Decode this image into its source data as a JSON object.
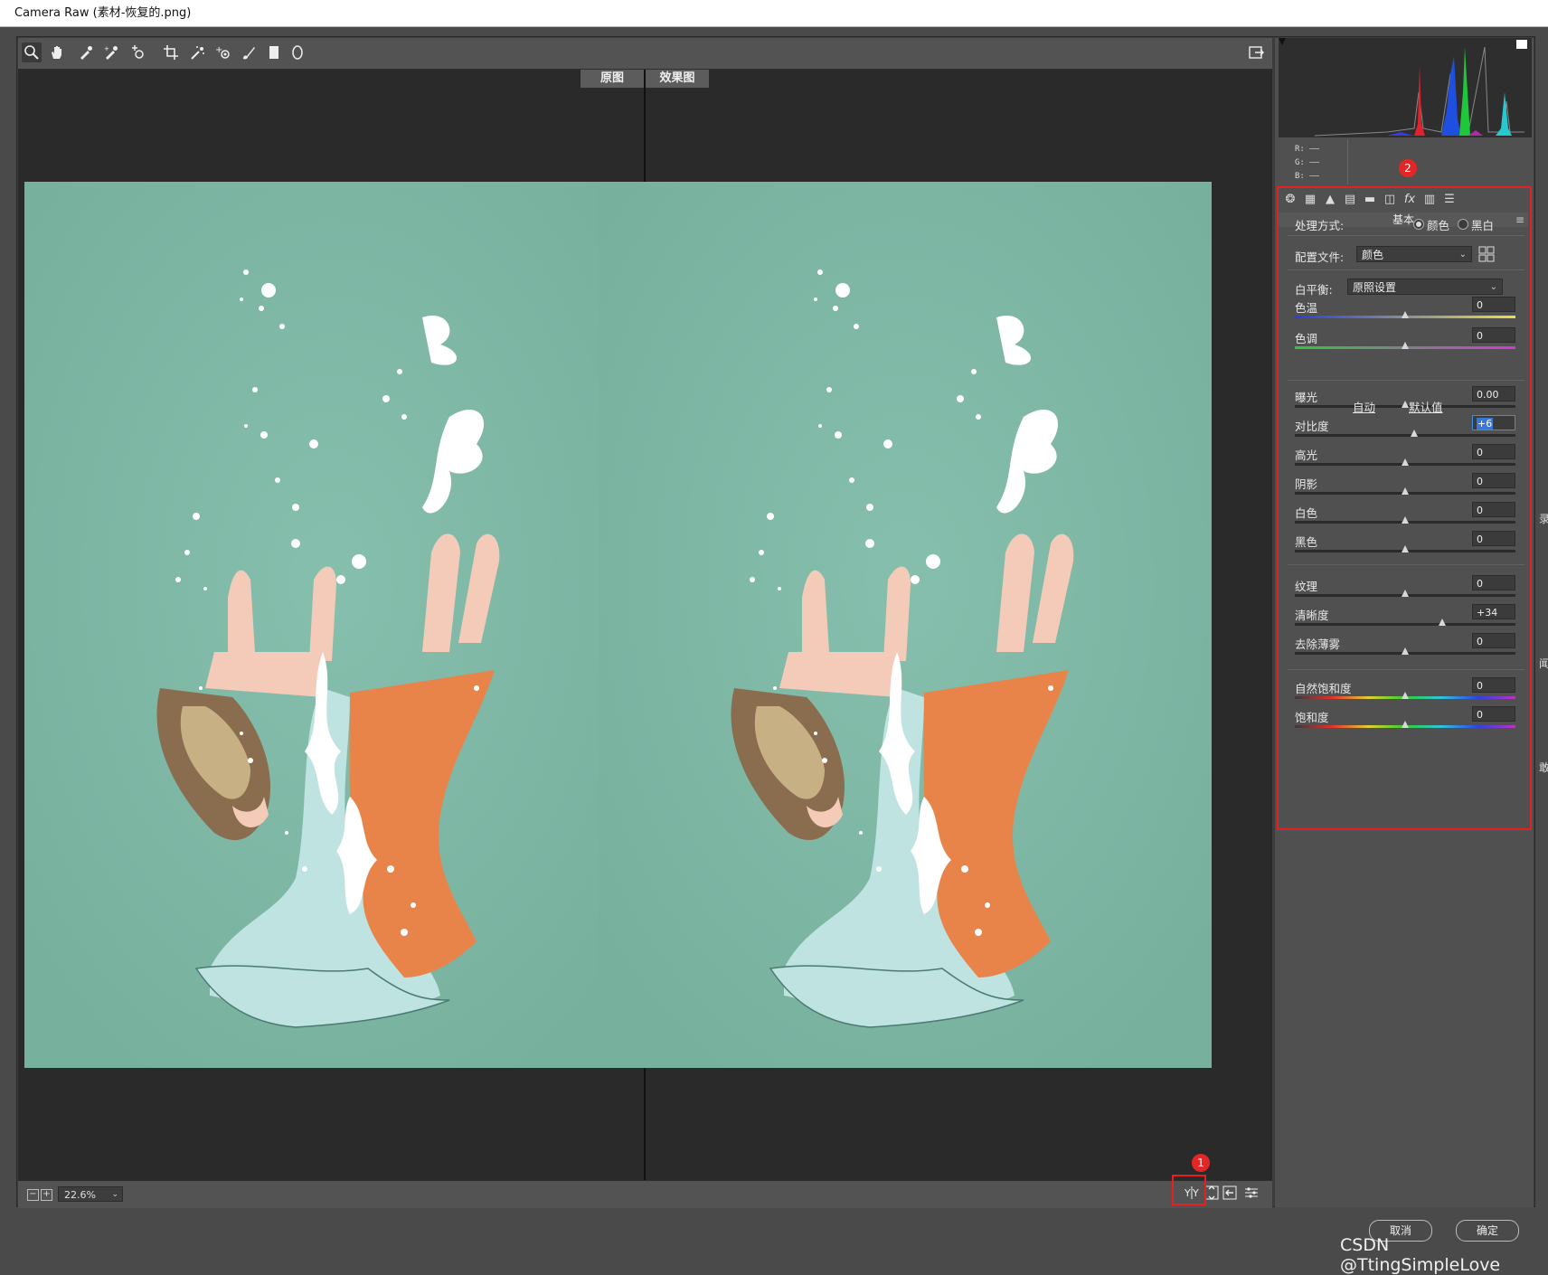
{
  "window": {
    "title": "Camera Raw (素材-恢复的.png)"
  },
  "toolbar": {
    "tools": [
      {
        "icon": "zoom-icon",
        "glyph": "🔍"
      },
      {
        "icon": "hand-icon",
        "glyph": "✋"
      },
      {
        "icon": "white-balance-icon",
        "glyph": "✎"
      },
      {
        "icon": "color-sampler-icon",
        "glyph": "✎"
      },
      {
        "icon": "targeted-adjustment-icon",
        "glyph": "⊕"
      },
      {
        "icon": "crop-icon",
        "glyph": "⌗"
      },
      {
        "icon": "spot-removal-icon",
        "glyph": "✦"
      },
      {
        "icon": "red-eye-icon",
        "glyph": "+"
      },
      {
        "icon": "adjustment-brush-icon",
        "glyph": "✐"
      },
      {
        "icon": "graduated-filter-icon",
        "glyph": "▮"
      },
      {
        "icon": "radial-filter-icon",
        "glyph": "◯"
      }
    ]
  },
  "view": {
    "before_label": "原图",
    "after_label": "效果图"
  },
  "bottom": {
    "zoom_out": "−",
    "zoom_in": "+",
    "zoom_value": "22.6%",
    "badge_1": "1"
  },
  "histogram": {
    "readout_r": "R:   ——",
    "readout_g": "G:   ——",
    "readout_b": "B:   ——",
    "badge_2": "2"
  },
  "basic": {
    "section_title": "基本",
    "treatment_label": "处理方式:",
    "color_option": "颜色",
    "bw_option": "黑白",
    "profile_label": "配置文件:",
    "profile_value": "颜色",
    "wb_label": "白平衡:",
    "wb_value": "原照设置",
    "auto_link": "自动",
    "default_link": "默认值",
    "sliders": [
      {
        "label": "色温",
        "value": "0",
        "pos": 0.5
      },
      {
        "label": "色调",
        "value": "0",
        "pos": 0.5
      },
      {
        "label": "曝光",
        "value": "0.00",
        "pos": 0.5
      },
      {
        "label": "对比度",
        "value": "+6",
        "pos": 0.54
      },
      {
        "label": "高光",
        "value": "0",
        "pos": 0.5
      },
      {
        "label": "阴影",
        "value": "0",
        "pos": 0.5
      },
      {
        "label": "白色",
        "value": "0",
        "pos": 0.5
      },
      {
        "label": "黑色",
        "value": "0",
        "pos": 0.5
      },
      {
        "label": "纹理",
        "value": "0",
        "pos": 0.5
      },
      {
        "label": "清晰度",
        "value": "+34",
        "pos": 0.67
      },
      {
        "label": "去除薄雾",
        "value": "0",
        "pos": 0.5
      },
      {
        "label": "自然饱和度",
        "value": "0",
        "pos": 0.5
      },
      {
        "label": "饱和度",
        "value": "0",
        "pos": 0.5
      }
    ]
  },
  "footer": {
    "cancel": "取消",
    "ok": "确定",
    "watermark": "CSDN @TtingSimpleLove"
  }
}
